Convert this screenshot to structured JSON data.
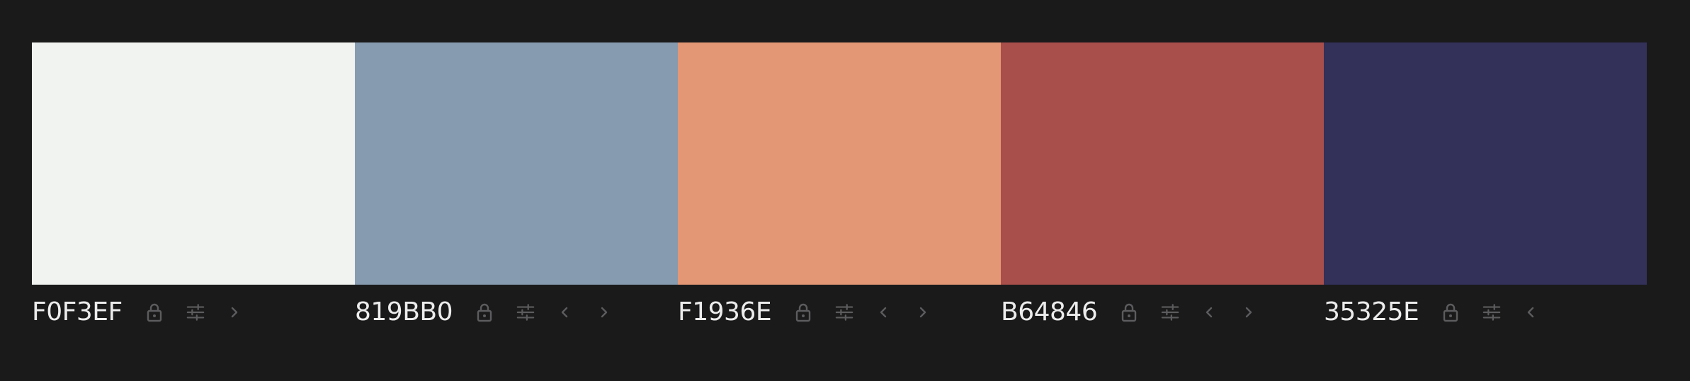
{
  "colors": [
    {
      "hex": "F0F3EF",
      "swatch": "#F0F3EF",
      "has_prev": false,
      "has_next": true
    },
    {
      "hex": "819BB0",
      "swatch": "#869BB0",
      "has_prev": true,
      "has_next": true
    },
    {
      "hex": "F1936E",
      "swatch": "#E39775",
      "has_prev": true,
      "has_next": true
    },
    {
      "hex": "B64846",
      "swatch": "#A84F4B",
      "has_prev": true,
      "has_next": true
    },
    {
      "hex": "35325E",
      "swatch": "#33305A",
      "has_prev": true,
      "has_next": false
    }
  ],
  "icons": {
    "lock": "lock-icon",
    "adjust": "sliders-icon",
    "prev": "chevron-left-icon",
    "next": "chevron-right-icon"
  },
  "theme": {
    "background": "#1a1a1b",
    "text": "#ececec",
    "icon": "#5c5c5e"
  }
}
